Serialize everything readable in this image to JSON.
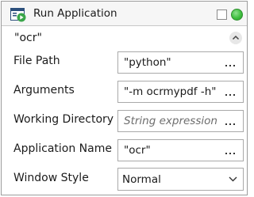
{
  "header": {
    "title": "Run Application",
    "icon": "run-application-icon"
  },
  "display_name": "\"ocr\"",
  "fields": {
    "file_path": {
      "label": "File Path",
      "value": "\"python\""
    },
    "arguments": {
      "label": "Arguments",
      "value": "\"-m ocrmypdf -h\""
    },
    "working_directory": {
      "label": "Working Directory",
      "placeholder": "String expression"
    },
    "application_name": {
      "label": "Application Name",
      "value": "\"ocr\""
    },
    "window_style": {
      "label": "Window Style",
      "selected": "Normal"
    }
  },
  "colors": {
    "status_dot": "#3fbf3f",
    "border": "#a9a9a9"
  }
}
